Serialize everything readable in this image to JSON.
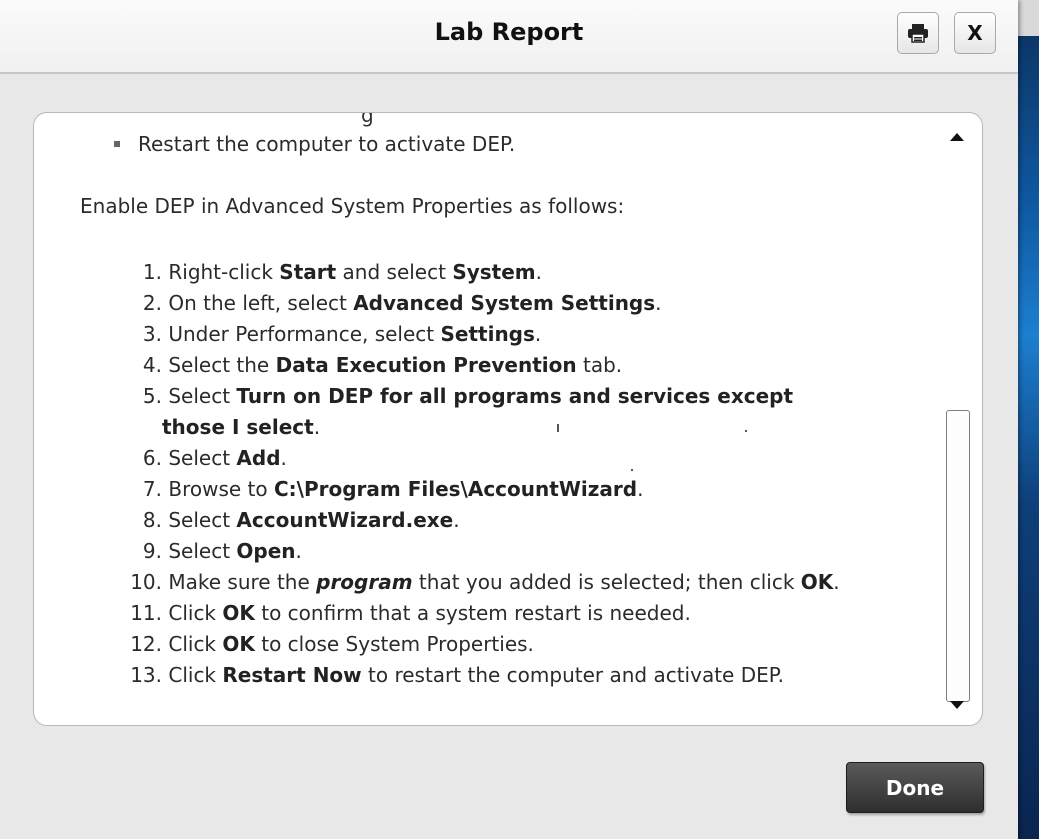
{
  "window": {
    "title": "Lab Report",
    "print_icon": "printer-icon",
    "close_label": "X"
  },
  "content": {
    "partial_top_line": "g",
    "bullet": "Restart the computer to activate DEP.",
    "intro": "Enable DEP in Advanced System Properties as follows:",
    "steps": [
      {
        "num": "1.",
        "parts": [
          "Right-click ",
          "Start",
          " and select ",
          "System",
          "."
        ]
      },
      {
        "num": "2.",
        "parts": [
          "On the left, select ",
          "Advanced System Settings",
          "."
        ]
      },
      {
        "num": "3.",
        "parts": [
          "Under Performance, select ",
          "Settings",
          "."
        ]
      },
      {
        "num": "4.",
        "parts": [
          "Select the ",
          "Data Execution Prevention",
          " tab."
        ]
      },
      {
        "num": "5.",
        "parts": [
          "Select ",
          "Turn on DEP for all programs and services except those I select",
          "."
        ]
      },
      {
        "num": "6.",
        "parts": [
          "Select ",
          "Add",
          "."
        ]
      },
      {
        "num": "7.",
        "parts": [
          "Browse to ",
          "C:\\Program Files\\AccountWizard",
          "."
        ]
      },
      {
        "num": "8.",
        "parts": [
          "Select ",
          "AccountWizard.exe",
          "."
        ]
      },
      {
        "num": "9.",
        "parts": [
          "Select ",
          "Open",
          "."
        ]
      },
      {
        "num": "10.",
        "parts": [
          "Make sure the ",
          "program",
          " that you added is selected; then click ",
          "OK",
          "."
        ]
      },
      {
        "num": "11.",
        "parts": [
          "Click ",
          "OK",
          " to confirm that a system restart is needed."
        ]
      },
      {
        "num": "12.",
        "parts": [
          "Click ",
          "OK",
          " to close System Properties."
        ]
      },
      {
        "num": "13.",
        "parts": [
          "Click ",
          "Restart Now",
          " to restart the computer and activate DEP."
        ]
      }
    ]
  },
  "footer": {
    "done_label": "Done"
  }
}
